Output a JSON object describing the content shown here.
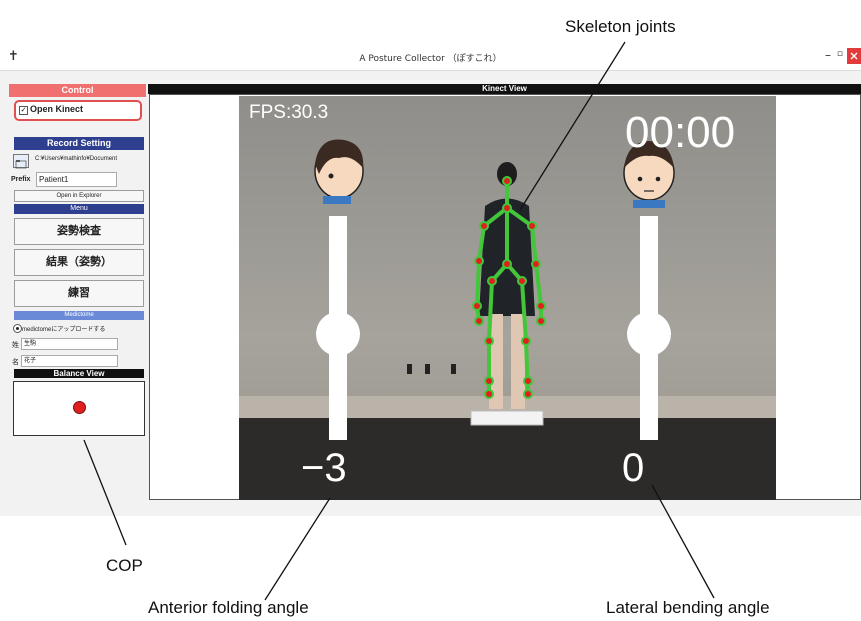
{
  "window": {
    "title": "A Posture Collector （ぽすこれ）",
    "app_icon": "pin-icon",
    "min_glyph": "–",
    "max_glyph": "▫"
  },
  "control": {
    "header": "Control",
    "open_kinect": "Open Kinect",
    "open_kinect_checked": true
  },
  "record_setting": {
    "header": "Record Setting",
    "path": "C:¥Users¥mathinfo¥Document",
    "prefix_label": "Prefix",
    "prefix_value": "Patient1",
    "open_explorer": "Open in Explorer"
  },
  "menu": {
    "header": "Menu",
    "items": [
      "姿勢検査",
      "結果（姿勢）",
      "練習"
    ]
  },
  "medictome": {
    "header": "Medictome",
    "upload_label": "medictomeにアップロードする",
    "last_name_label": "姓",
    "last_name_value": "生駒",
    "first_name_label": "名",
    "first_name_value": "花子"
  },
  "balance": {
    "header": "Balance View"
  },
  "kinect": {
    "header": "Kinect View",
    "fps": "FPS:30.3",
    "timer": "00:00",
    "left_angle": "−3",
    "right_angle": "0",
    "left_slider_level": 0.5,
    "right_slider_level": 0.5
  },
  "annotations": {
    "skeleton": "Skeleton joints",
    "cop": "COP",
    "anterior": "Anterior folding angle",
    "lateral": "Lateral bending angle"
  },
  "colors": {
    "header_red": "#f07070",
    "header_navy": "#2f3f8f",
    "header_blue": "#6a8ad8",
    "header_black": "#111111",
    "skeleton_green": "#43c63a",
    "joint_red": "#e02020",
    "cop_red": "#e02020",
    "open_kinect_border": "#e05050"
  }
}
